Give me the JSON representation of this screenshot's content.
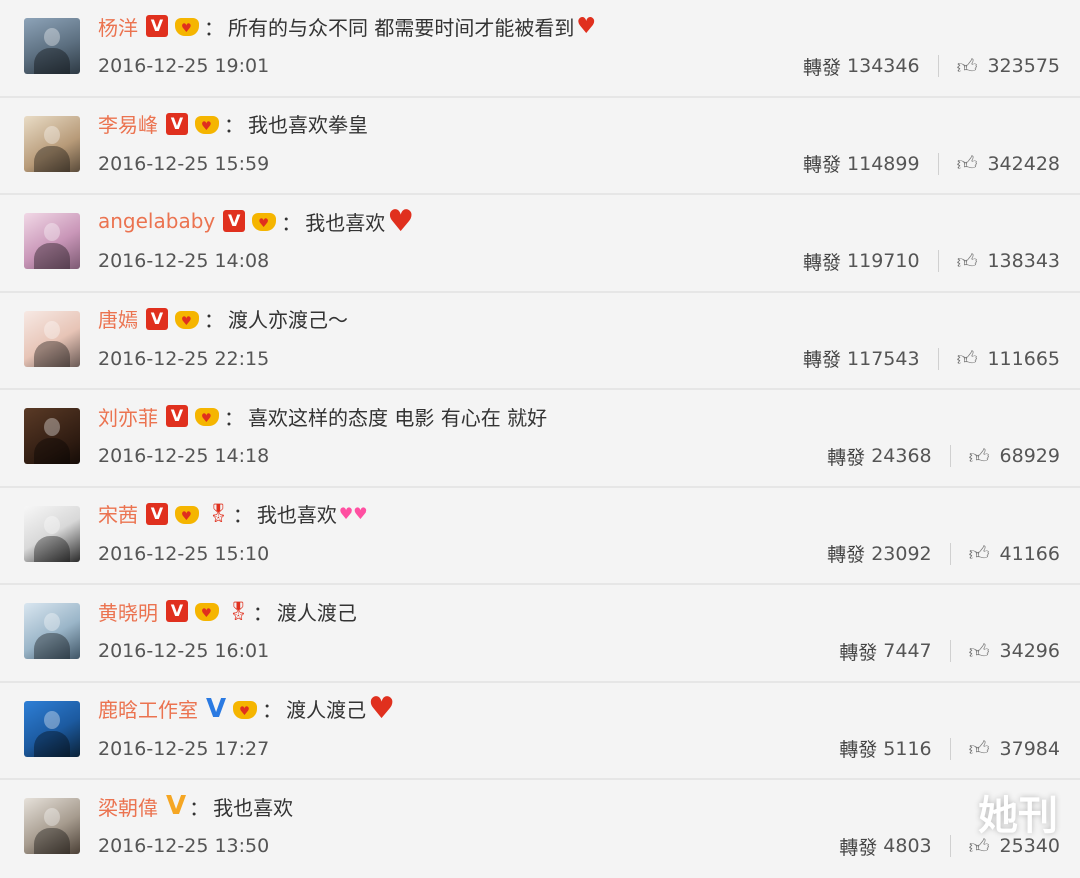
{
  "repost_label": "轉發",
  "colors": {
    "name": "#eb7350",
    "badge_red": "#e0301e",
    "badge_blue": "#2a7ae2",
    "badge_gold": "#f5a623"
  },
  "comments": [
    {
      "name": "杨洋",
      "message": "所有的与众不同 都需要时间才能被看到",
      "time": "2016-12-25 19:01",
      "reposts": "134346",
      "likes": "323575"
    },
    {
      "name": "李易峰",
      "message": "我也喜欢拳皇",
      "time": "2016-12-25 15:59",
      "reposts": "114899",
      "likes": "342428"
    },
    {
      "name": "angelababy",
      "message": "我也喜欢",
      "time": "2016-12-25 14:08",
      "reposts": "119710",
      "likes": "138343"
    },
    {
      "name": "唐嫣",
      "message": "渡人亦渡己～",
      "time": "2016-12-25 22:15",
      "reposts": "117543",
      "likes": "111665"
    },
    {
      "name": "刘亦菲",
      "message": "喜欢这样的态度 电影 有心在 就好",
      "time": "2016-12-25 14:18",
      "reposts": "24368",
      "likes": "68929"
    },
    {
      "name": "宋茜",
      "message": "我也喜欢",
      "time": "2016-12-25 15:10",
      "reposts": "23092",
      "likes": "41166"
    },
    {
      "name": "黄晓明",
      "message": "渡人渡己",
      "time": "2016-12-25 16:01",
      "reposts": "7447",
      "likes": "34296"
    },
    {
      "name": "鹿晗工作室",
      "message": "渡人渡己",
      "time": "2016-12-25 17:27",
      "reposts": "5116",
      "likes": "37984"
    },
    {
      "name": "梁朝偉",
      "message": "我也喜欢",
      "time": "2016-12-25 13:50",
      "reposts": "4803",
      "likes": "25340"
    }
  ],
  "badge_letter": "V",
  "watermark": "她刊"
}
